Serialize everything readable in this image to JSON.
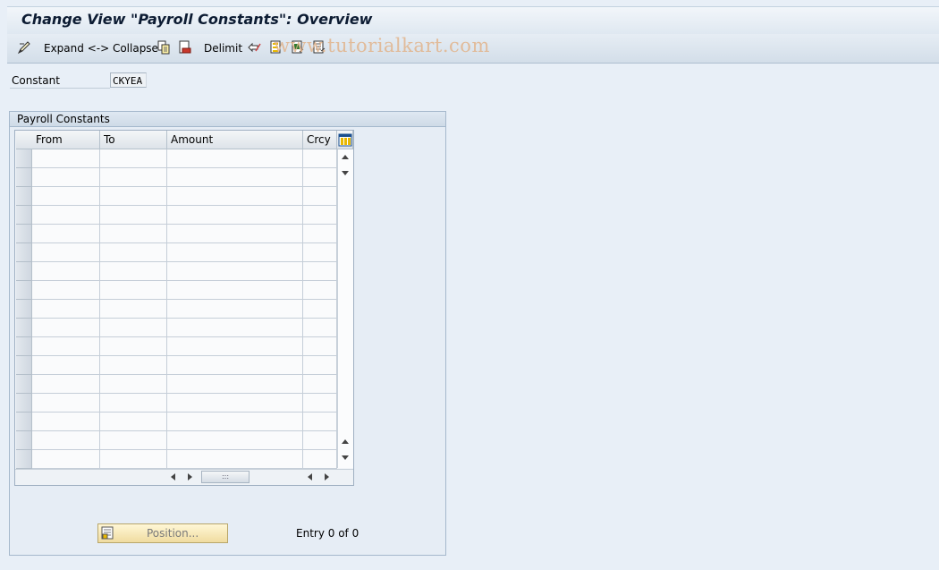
{
  "window": {
    "title": "Change View \"Payroll Constants\": Overview"
  },
  "toolbar": {
    "expand_collapse_label": "Expand <-> Collapse",
    "delimit_label": "Delimit",
    "icons": [
      "change-display-icon",
      "copy-icon",
      "delete-icon",
      "undo-change-icon",
      "select-all-icon",
      "select-block-icon",
      "deselect-all-icon"
    ],
    "watermark": "www.tutorialkart.com"
  },
  "constant": {
    "label": "Constant",
    "value": "CKYEA"
  },
  "group": {
    "title": "Payroll Constants"
  },
  "table": {
    "columns": [
      "From",
      "To",
      "Amount",
      "Crcy"
    ],
    "rows": 17,
    "settings_icon": "table-settings-icon"
  },
  "footer": {
    "position_label": "Position...",
    "entry_text": "Entry 0 of 0"
  }
}
